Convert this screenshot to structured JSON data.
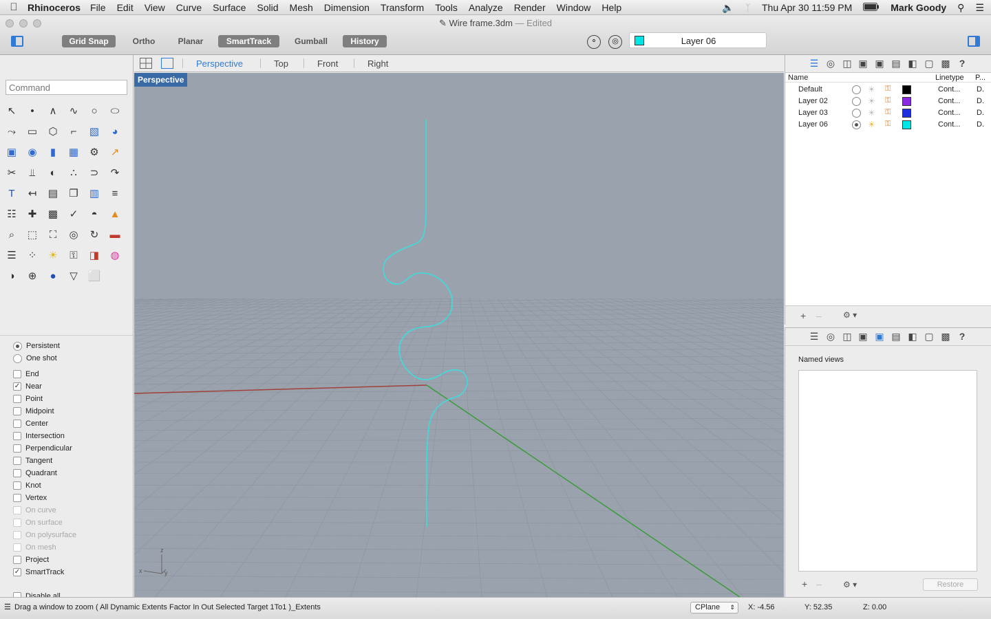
{
  "menubar": {
    "app_name": "Rhinoceros",
    "items": [
      "File",
      "Edit",
      "View",
      "Curve",
      "Surface",
      "Solid",
      "Mesh",
      "Dimension",
      "Transform",
      "Tools",
      "Analyze",
      "Render",
      "Window",
      "Help"
    ],
    "datetime": "Thu Apr 30  11:59 PM",
    "user": "Mark Goody"
  },
  "window": {
    "title": "Wire frame.3dm",
    "edited": "— Edited"
  },
  "toolbar": {
    "grid_snap": "Grid Snap",
    "ortho": "Ortho",
    "planar": "Planar",
    "smarttrack": "SmartTrack",
    "gumball": "Gumball",
    "history": "History",
    "current_layer": "Layer 06",
    "current_layer_color": "#00e5e5"
  },
  "command": {
    "placeholder": "Command"
  },
  "tools": [
    "select-arrow-icon",
    "point-icon",
    "polyline-icon",
    "curve-icon",
    "circle-icon",
    "ellipse-icon",
    "polyline-draw-icon",
    "rectangle-icon",
    "polygon-icon",
    "fillet-icon",
    "surface-icon",
    "patch-icon",
    "box-icon",
    "sphere-union-icon",
    "cylinder-icon",
    "mesh-plane-icon",
    "gears-icon",
    "explode-icon",
    "trim-icon",
    "split-icon",
    "boolean-icon",
    "group-icon",
    "join-icon",
    "offset-icon",
    "text-icon",
    "dimension-icon",
    "array-icon",
    "copy-icon",
    "block-icon",
    "hatch-icon",
    "grid-array-icon",
    "gumball-icon",
    "lock-sheet-icon",
    "check-icon",
    "dome-icon",
    "paint-icon",
    "zoom-icon",
    "zoom-window-icon",
    "zoom-extents-icon",
    "zoom-selected-icon",
    "rotate-view-icon",
    "car-icon",
    "layer-tools-icon",
    "points-icon",
    "light-bulb-icon",
    "lock-icon",
    "material-icon",
    "color-wheel-icon",
    "sphere-icon",
    "globe-icon",
    "render-ball-icon",
    "flag-icon",
    "cplane-icon",
    ""
  ],
  "osnaps": {
    "modes": [
      {
        "label": "Persistent",
        "selected": true
      },
      {
        "label": "One shot",
        "selected": false
      }
    ],
    "items": [
      {
        "label": "End",
        "checked": false,
        "disabled": false
      },
      {
        "label": "Near",
        "checked": true,
        "disabled": false
      },
      {
        "label": "Point",
        "checked": false,
        "disabled": false
      },
      {
        "label": "Midpoint",
        "checked": false,
        "disabled": false
      },
      {
        "label": "Center",
        "checked": false,
        "disabled": false
      },
      {
        "label": "Intersection",
        "checked": false,
        "disabled": false
      },
      {
        "label": "Perpendicular",
        "checked": false,
        "disabled": false
      },
      {
        "label": "Tangent",
        "checked": false,
        "disabled": false
      },
      {
        "label": "Quadrant",
        "checked": false,
        "disabled": false
      },
      {
        "label": "Knot",
        "checked": false,
        "disabled": false
      },
      {
        "label": "Vertex",
        "checked": false,
        "disabled": false
      },
      {
        "label": "On curve",
        "checked": false,
        "disabled": true
      },
      {
        "label": "On surface",
        "checked": false,
        "disabled": true
      },
      {
        "label": "On polysurface",
        "checked": false,
        "disabled": true
      },
      {
        "label": "On mesh",
        "checked": false,
        "disabled": true
      },
      {
        "label": "Project",
        "checked": false,
        "disabled": false
      },
      {
        "label": "SmartTrack",
        "checked": true,
        "disabled": false
      }
    ],
    "disable_all": "Disable all"
  },
  "viewport_tabs": {
    "perspective": "Perspective",
    "top": "Top",
    "front": "Front",
    "right": "Right"
  },
  "viewport": {
    "label": "Perspective",
    "curve_color": "#3fdcdc",
    "x_axis_color": "#a0403a",
    "y_axis_color": "#3a9a3a",
    "background": "#9aa3ad",
    "axis_icon": {
      "z": "z",
      "x": "x",
      "y": "y"
    }
  },
  "layers": {
    "headers": {
      "name": "Name",
      "linetype": "Linetype",
      "print": "P..."
    },
    "rows": [
      {
        "name": "Default",
        "current": false,
        "visible": false,
        "color": "#000000",
        "linetype": "Cont...",
        "print": "D."
      },
      {
        "name": "Layer 02",
        "current": false,
        "visible": false,
        "color": "#8a2be2",
        "linetype": "Cont...",
        "print": "D."
      },
      {
        "name": "Layer 03",
        "current": false,
        "visible": false,
        "color": "#1f2fe0",
        "linetype": "Cont...",
        "print": "D."
      },
      {
        "name": "Layer 06",
        "current": true,
        "visible": true,
        "color": "#00e5e5",
        "linetype": "Cont...",
        "print": "D."
      }
    ]
  },
  "named_views": {
    "title": "Named views",
    "restore": "Restore"
  },
  "statusbar": {
    "message": "Drag a window to zoom ( All  Dynamic  Extents  Factor  In  Out  Selected  Target  1To1 )_Extents",
    "cplane": "CPlane",
    "x": "X: -4.56",
    "y": "Y: 52.35",
    "z": "Z: 0.00"
  }
}
